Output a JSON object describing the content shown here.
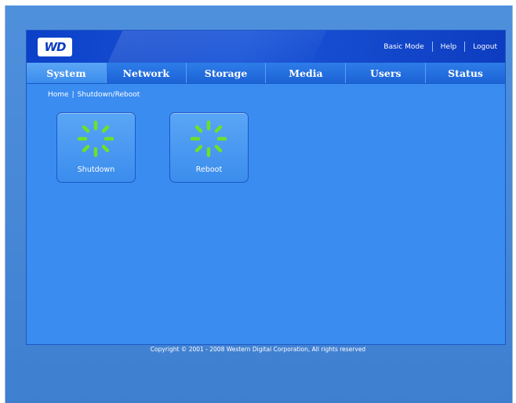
{
  "header": {
    "logo_text": "WD",
    "links": [
      "Basic Mode",
      "Help",
      "Logout"
    ]
  },
  "tabs": [
    "System",
    "Network",
    "Storage",
    "Media",
    "Users",
    "Status"
  ],
  "active_tab": "System",
  "breadcrumb": {
    "home": "Home",
    "current": "Shutdown/Reboot"
  },
  "actions": [
    {
      "label": "Shutdown",
      "icon": "spinner-icon"
    },
    {
      "label": "Reboot",
      "icon": "spinner-icon"
    }
  ],
  "footer": "Copyright © 2001 - 2008 Western Digital Corporation, All rights reserved",
  "colors": {
    "accent_green": "#6ee02a",
    "header_blue": "#0b40c8",
    "content_blue": "#3a8cf0"
  }
}
